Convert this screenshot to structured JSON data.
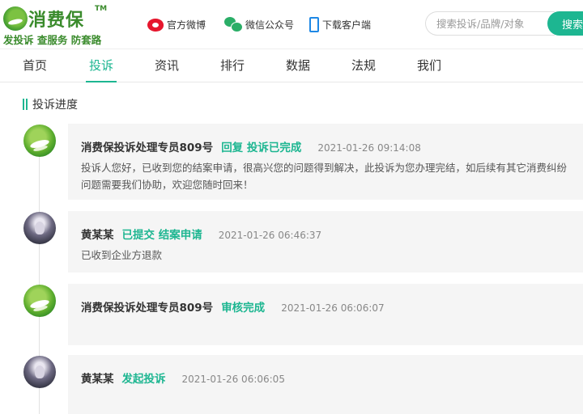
{
  "header": {
    "logo_name": "消费保",
    "logo_tm": "TM",
    "slogan": "发投诉 查服务 防套路",
    "links": [
      {
        "label": "官方微博",
        "icon": "weibo-icon"
      },
      {
        "label": "微信公众号",
        "icon": "wechat-icon"
      },
      {
        "label": "下载客户端",
        "icon": "phone-icon"
      }
    ],
    "search_placeholder": "搜索投诉/品牌/对象",
    "search_button": "搜索"
  },
  "nav": {
    "items": [
      "首页",
      "投诉",
      "资讯",
      "排行",
      "数据",
      "法规",
      "我们"
    ],
    "active": "投诉"
  },
  "section": {
    "title": "投诉进度"
  },
  "progress": [
    {
      "avatar": "agent",
      "author": "消费保投诉处理专员809号",
      "action": "回复 投诉已完成",
      "time": "2021-01-26 09:14:08",
      "body": "投诉人您好，已收到您的结案申请，很高兴您的问题得到解决，此投诉为您办理完结，如后续有其它消费纠纷问题需要我们协助，欢迎您随时回来！"
    },
    {
      "avatar": "user",
      "author": "黄某某",
      "action": "已提交 结案申请",
      "time": "2021-01-26 06:46:37",
      "body": "已收到企业方退款"
    },
    {
      "avatar": "agent",
      "author": "消费保投诉处理专员809号",
      "action": "审核完成",
      "time": "2021-01-26 06:06:07",
      "body": ""
    },
    {
      "avatar": "user",
      "author": "黄某某",
      "action": "发起投诉",
      "time": "2021-01-26 06:06:05",
      "body": ""
    }
  ],
  "colors": {
    "accent": "#1db691",
    "brand_green": "#3a8b2c",
    "card_bg": "#f5f5f5"
  }
}
